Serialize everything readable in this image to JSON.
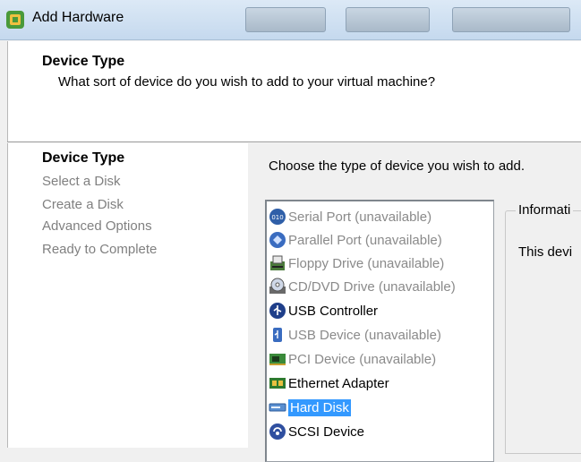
{
  "window": {
    "title": "Add Hardware",
    "icon": "vm-hardware-icon"
  },
  "header": {
    "title": "Device Type",
    "subtitle": "What sort of device do you wish to add to your virtual machine?"
  },
  "steps": [
    {
      "label": "Device Type",
      "current": true
    },
    {
      "label": "Select a Disk",
      "current": false
    },
    {
      "label": "Create a Disk",
      "current": false
    },
    {
      "label": "Advanced Options",
      "current": false
    },
    {
      "label": "Ready to Complete",
      "current": false
    }
  ],
  "main": {
    "instruction": "Choose the type of device you wish to add.",
    "devices": [
      {
        "label": "Serial Port (unavailable)",
        "icon": "serial-port-icon",
        "enabled": false
      },
      {
        "label": "Parallel Port (unavailable)",
        "icon": "parallel-port-icon",
        "enabled": false
      },
      {
        "label": "Floppy Drive (unavailable)",
        "icon": "floppy-drive-icon",
        "enabled": false
      },
      {
        "label": "CD/DVD Drive (unavailable)",
        "icon": "cd-dvd-drive-icon",
        "enabled": false
      },
      {
        "label": "USB Controller",
        "icon": "usb-controller-icon",
        "enabled": true
      },
      {
        "label": "USB Device (unavailable)",
        "icon": "usb-device-icon",
        "enabled": false
      },
      {
        "label": "PCI Device (unavailable)",
        "icon": "pci-device-icon",
        "enabled": false
      },
      {
        "label": "Ethernet Adapter",
        "icon": "ethernet-adapter-icon",
        "enabled": true
      },
      {
        "label": "Hard Disk",
        "icon": "hard-disk-icon",
        "enabled": true,
        "selected": true
      },
      {
        "label": "SCSI Device",
        "icon": "scsi-device-icon",
        "enabled": true
      }
    ],
    "info_group_label": "Informati",
    "info_text": "This devi"
  },
  "colors": {
    "selection": "#3399ff",
    "disabled_text": "#8a8a8a"
  }
}
